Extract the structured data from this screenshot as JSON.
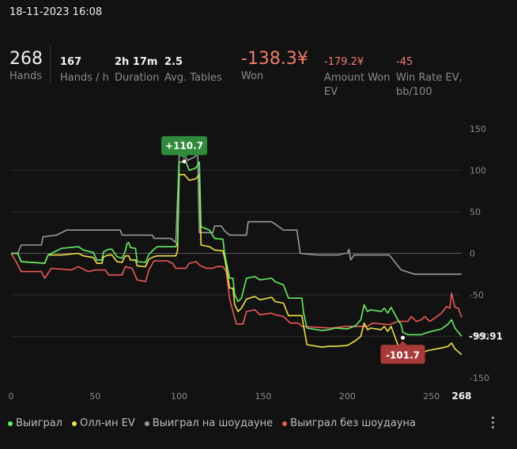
{
  "header": {
    "datetime": "18-11-2023 16:08"
  },
  "stats": {
    "hands": {
      "value": "268",
      "label": "Hands"
    },
    "hands_per_hour": {
      "value": "167",
      "label": "Hands / h"
    },
    "duration": {
      "value": "2h 17m",
      "label": "Duration"
    },
    "avg_tables": {
      "value": "2.5",
      "label": "Avg. Tables"
    },
    "won": {
      "value": "-138.3¥",
      "label": "Won"
    },
    "amount_won_ev": {
      "value": "-179.2¥",
      "label_1": "Amount Won",
      "label_2": "EV"
    },
    "win_rate_ev": {
      "value": "-45",
      "label_1": "Win Rate EV,",
      "label_2": "bb/100"
    }
  },
  "legend": [
    {
      "label": "Выиграл",
      "color": "#66ee66"
    },
    {
      "label": "Олл-ин EV",
      "color": "#f0e24a"
    },
    {
      "label": "Выиграл на шоудауне",
      "color": "#9a9a9a"
    },
    {
      "label": "Выиграл без шоудауна",
      "color": "#ee5a5a"
    }
  ],
  "chart_data": {
    "type": "line",
    "x_ticks": [
      0,
      50,
      100,
      150,
      200,
      250
    ],
    "x_max_label": "268",
    "xlim": [
      0,
      268
    ],
    "y_ticks": [
      150,
      100,
      50,
      0,
      -50,
      -100,
      -150
    ],
    "ylim": [
      -150,
      150
    ],
    "annotations": {
      "peak": {
        "label": "+110.7",
        "x": 103,
        "y": 110.7
      },
      "trough": {
        "label": "-101.7",
        "x": 233,
        "y": -101.7
      },
      "end_value": {
        "label": "-99.91",
        "x": 268,
        "y": -99.91
      }
    },
    "series": [
      {
        "name": "Выиграл",
        "color": "#66ee66",
        "points": [
          [
            0,
            0
          ],
          [
            4,
            0
          ],
          [
            6,
            -10
          ],
          [
            20,
            -12
          ],
          [
            22,
            -2
          ],
          [
            30,
            6
          ],
          [
            40,
            8
          ],
          [
            43,
            4
          ],
          [
            49,
            1
          ],
          [
            51,
            -8
          ],
          [
            54,
            -8
          ],
          [
            55,
            2
          ],
          [
            58,
            5
          ],
          [
            60,
            5
          ],
          [
            63,
            -4
          ],
          [
            66,
            -6
          ],
          [
            68,
            3
          ],
          [
            69,
            12
          ],
          [
            70,
            13
          ],
          [
            71,
            7
          ],
          [
            74,
            6
          ],
          [
            75,
            -10
          ],
          [
            80,
            -11
          ],
          [
            82,
            -1
          ],
          [
            85,
            5
          ],
          [
            87,
            8
          ],
          [
            98,
            8
          ],
          [
            99,
            14
          ],
          [
            100,
            110
          ],
          [
            104,
            110
          ],
          [
            106,
            100
          ],
          [
            110,
            103
          ],
          [
            112,
            110
          ],
          [
            113,
            32
          ],
          [
            118,
            28
          ],
          [
            121,
            18
          ],
          [
            126,
            17
          ],
          [
            127,
            0
          ],
          [
            130,
            -30
          ],
          [
            132,
            -30
          ],
          [
            133,
            -50
          ],
          [
            135,
            -58
          ],
          [
            137,
            -54
          ],
          [
            140,
            -30
          ],
          [
            145,
            -28
          ],
          [
            148,
            -32
          ],
          [
            155,
            -30
          ],
          [
            157,
            -34
          ],
          [
            162,
            -38
          ],
          [
            165,
            -54
          ],
          [
            173,
            -54
          ],
          [
            174,
            -72
          ],
          [
            176,
            -90
          ],
          [
            185,
            -93
          ],
          [
            189,
            -92
          ],
          [
            193,
            -90
          ],
          [
            200,
            -91
          ],
          [
            205,
            -87
          ],
          [
            208,
            -80
          ],
          [
            210,
            -62
          ],
          [
            212,
            -70
          ],
          [
            214,
            -68
          ],
          [
            220,
            -70
          ],
          [
            222,
            -66
          ],
          [
            224,
            -72
          ],
          [
            226,
            -65
          ],
          [
            230,
            -80
          ],
          [
            232,
            -86
          ],
          [
            233,
            -95
          ],
          [
            236,
            -98
          ],
          [
            244,
            -98
          ],
          [
            248,
            -95
          ],
          [
            256,
            -91
          ],
          [
            260,
            -85
          ],
          [
            262,
            -80
          ],
          [
            264,
            -90
          ],
          [
            268,
            -99.91
          ]
        ]
      },
      {
        "name": "Олл-ин EV",
        "color": "#f0e24a",
        "points": [
          [
            0,
            0
          ],
          [
            4,
            0
          ],
          [
            6,
            -10
          ],
          [
            20,
            -12
          ],
          [
            22,
            -2
          ],
          [
            30,
            -2
          ],
          [
            40,
            0
          ],
          [
            43,
            -3
          ],
          [
            49,
            -5
          ],
          [
            51,
            -12
          ],
          [
            54,
            -12
          ],
          [
            55,
            -4
          ],
          [
            58,
            -2
          ],
          [
            60,
            -2
          ],
          [
            63,
            -10
          ],
          [
            66,
            -11
          ],
          [
            68,
            -3
          ],
          [
            70,
            -3
          ],
          [
            71,
            -8
          ],
          [
            74,
            -8
          ],
          [
            75,
            -15
          ],
          [
            80,
            -16
          ],
          [
            82,
            -7
          ],
          [
            85,
            -4
          ],
          [
            87,
            -3
          ],
          [
            98,
            -3
          ],
          [
            99,
            3
          ],
          [
            100,
            95
          ],
          [
            103,
            95
          ],
          [
            106,
            88
          ],
          [
            110,
            90
          ],
          [
            112,
            95
          ],
          [
            113,
            10
          ],
          [
            118,
            8
          ],
          [
            121,
            4
          ],
          [
            126,
            3
          ],
          [
            127,
            -5
          ],
          [
            130,
            -42
          ],
          [
            132,
            -42
          ],
          [
            133,
            -62
          ],
          [
            135,
            -70
          ],
          [
            137,
            -66
          ],
          [
            140,
            -55
          ],
          [
            145,
            -52
          ],
          [
            148,
            -56
          ],
          [
            155,
            -53
          ],
          [
            157,
            -58
          ],
          [
            162,
            -60
          ],
          [
            165,
            -75
          ],
          [
            173,
            -75
          ],
          [
            174,
            -88
          ],
          [
            176,
            -110
          ],
          [
            185,
            -113
          ],
          [
            189,
            -112
          ],
          [
            193,
            -112
          ],
          [
            200,
            -111
          ],
          [
            205,
            -105
          ],
          [
            208,
            -100
          ],
          [
            210,
            -84
          ],
          [
            212,
            -92
          ],
          [
            214,
            -90
          ],
          [
            220,
            -92
          ],
          [
            222,
            -88
          ],
          [
            224,
            -94
          ],
          [
            226,
            -88
          ],
          [
            230,
            -110
          ],
          [
            232,
            -116
          ],
          [
            233,
            -118
          ],
          [
            236,
            -122
          ],
          [
            244,
            -120
          ],
          [
            248,
            -117
          ],
          [
            256,
            -114
          ],
          [
            260,
            -112
          ],
          [
            262,
            -108
          ],
          [
            264,
            -115
          ],
          [
            268,
            -122
          ]
        ]
      },
      {
        "name": "Выиграл на шоудауне",
        "color": "#9a9a9a",
        "points": [
          [
            0,
            0
          ],
          [
            4,
            0
          ],
          [
            6,
            10
          ],
          [
            18,
            10
          ],
          [
            19,
            20
          ],
          [
            27,
            22
          ],
          [
            33,
            28
          ],
          [
            65,
            28
          ],
          [
            66,
            22
          ],
          [
            84,
            22
          ],
          [
            85,
            18
          ],
          [
            95,
            18
          ],
          [
            98,
            13
          ],
          [
            100,
            118
          ],
          [
            103,
            118
          ],
          [
            105,
            112
          ],
          [
            109,
            116
          ],
          [
            111,
            120
          ],
          [
            112,
            25
          ],
          [
            120,
            25
          ],
          [
            121,
            33
          ],
          [
            125,
            33
          ],
          [
            127,
            27
          ],
          [
            130,
            22
          ],
          [
            140,
            22
          ],
          [
            141,
            38
          ],
          [
            155,
            38
          ],
          [
            158,
            34
          ],
          [
            162,
            28
          ],
          [
            170,
            28
          ],
          [
            172,
            0
          ],
          [
            182,
            -2
          ],
          [
            195,
            -2
          ],
          [
            198,
            0
          ],
          [
            200,
            0
          ],
          [
            201,
            5
          ],
          [
            202,
            -8
          ],
          [
            204,
            -2
          ],
          [
            225,
            -2
          ],
          [
            232,
            -20
          ],
          [
            240,
            -25
          ],
          [
            268,
            -25
          ]
        ]
      },
      {
        "name": "Выиграл без шоудауна",
        "color": "#ee5a5a",
        "points": [
          [
            0,
            0
          ],
          [
            3,
            -10
          ],
          [
            6,
            -22
          ],
          [
            18,
            -22
          ],
          [
            20,
            -30
          ],
          [
            24,
            -18
          ],
          [
            36,
            -20
          ],
          [
            40,
            -16
          ],
          [
            46,
            -22
          ],
          [
            50,
            -20
          ],
          [
            56,
            -20
          ],
          [
            58,
            -26
          ],
          [
            66,
            -26
          ],
          [
            68,
            -16
          ],
          [
            72,
            -18
          ],
          [
            75,
            -32
          ],
          [
            80,
            -34
          ],
          [
            82,
            -20
          ],
          [
            85,
            -9
          ],
          [
            93,
            -9
          ],
          [
            96,
            -12
          ],
          [
            98,
            -18
          ],
          [
            104,
            -18
          ],
          [
            106,
            -12
          ],
          [
            110,
            -10
          ],
          [
            112,
            -14
          ],
          [
            116,
            -18
          ],
          [
            120,
            -18
          ],
          [
            122,
            -16
          ],
          [
            126,
            -16
          ],
          [
            128,
            -22
          ],
          [
            130,
            -55
          ],
          [
            134,
            -85
          ],
          [
            138,
            -85
          ],
          [
            140,
            -70
          ],
          [
            145,
            -68
          ],
          [
            148,
            -74
          ],
          [
            155,
            -72
          ],
          [
            157,
            -74
          ],
          [
            162,
            -76
          ],
          [
            166,
            -84
          ],
          [
            171,
            -84
          ],
          [
            173,
            -88
          ],
          [
            190,
            -90
          ],
          [
            200,
            -88
          ],
          [
            212,
            -88
          ],
          [
            215,
            -84
          ],
          [
            225,
            -86
          ],
          [
            230,
            -82
          ],
          [
            236,
            -82
          ],
          [
            238,
            -76
          ],
          [
            241,
            -82
          ],
          [
            244,
            -80
          ],
          [
            246,
            -76
          ],
          [
            249,
            -82
          ],
          [
            252,
            -78
          ],
          [
            256,
            -72
          ],
          [
            259,
            -64
          ],
          [
            261,
            -66
          ],
          [
            262,
            -48
          ],
          [
            264,
            -65
          ],
          [
            266,
            -66
          ],
          [
            268,
            -77
          ]
        ]
      }
    ]
  }
}
